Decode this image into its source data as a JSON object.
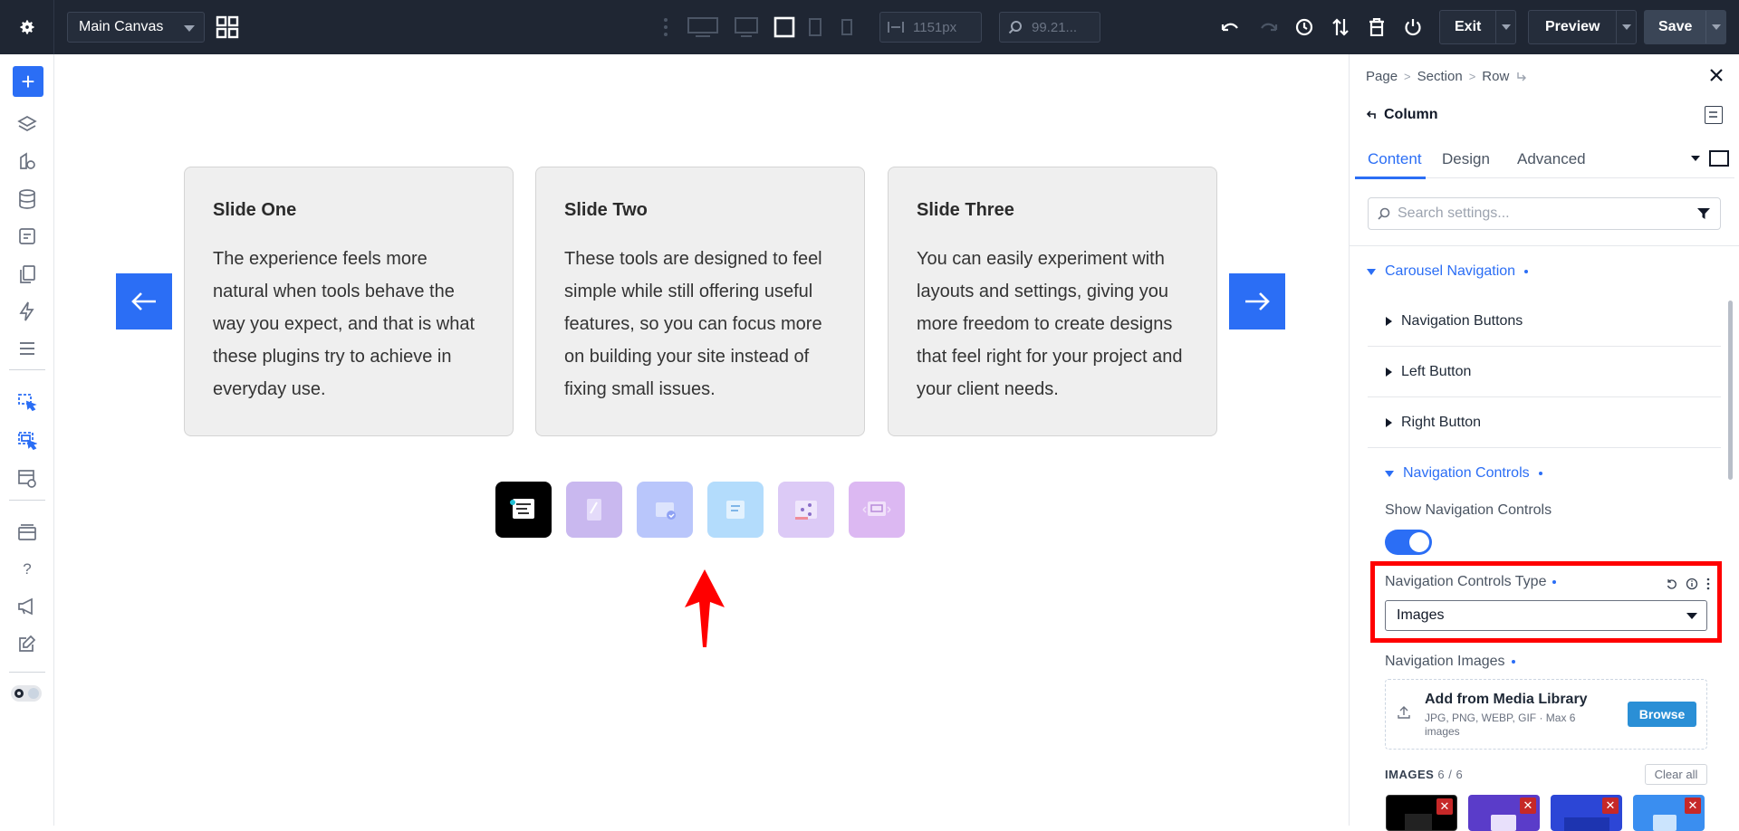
{
  "topbar": {
    "canvas_select": "Main Canvas",
    "width_value": "1151px",
    "zoom_value": "99.21...",
    "exit_label": "Exit",
    "preview_label": "Preview",
    "save_label": "Save"
  },
  "canvas": {
    "slides": [
      {
        "title": "Slide One",
        "body": "The experience feels more natural when tools behave the way you expect, and that is what these plugins try to achieve in everyday use."
      },
      {
        "title": "Slide Two",
        "body": "These tools are designed to feel simple while still offering useful features, so you can focus more on building your site instead of fixing small issues."
      },
      {
        "title": "Slide Three",
        "body": "You can easily experiment with layouts and settings, giving you more freedom to create designs that feel right for your project and your client needs."
      }
    ],
    "thumbnail_colors": [
      "#000000",
      "#c9b8ef",
      "#b9c6fb",
      "#b3dcfc",
      "#dccaf6",
      "#dcb8f2"
    ]
  },
  "panel": {
    "breadcrumb": [
      "Page",
      "Section",
      "Row"
    ],
    "element_title": "Column",
    "tabs": [
      "Content",
      "Design",
      "Advanced"
    ],
    "search_placeholder": "Search settings...",
    "carousel_navigation": "Carousel Navigation",
    "navigation_buttons": "Navigation Buttons",
    "left_button": "Left Button",
    "right_button": "Right Button",
    "navigation_controls": "Navigation Controls",
    "show_navigation_controls": "Show Navigation Controls",
    "show_navigation_controls_on": true,
    "navigation_controls_type_label": "Navigation Controls Type",
    "navigation_controls_type_value": "Images",
    "navigation_images_label": "Navigation Images",
    "upload_title": "Add from Media Library",
    "upload_subtitle": "JPG, PNG, WEBP, GIF · Max 6 images",
    "browse_label": "Browse",
    "images_header": "IMAGES",
    "images_count": "6 / 6",
    "clear_all_label": "Clear all"
  },
  "colors": {
    "accent": "#2b6ef5",
    "topbar_bg": "#1f2633",
    "highlight": "#ff0000"
  }
}
